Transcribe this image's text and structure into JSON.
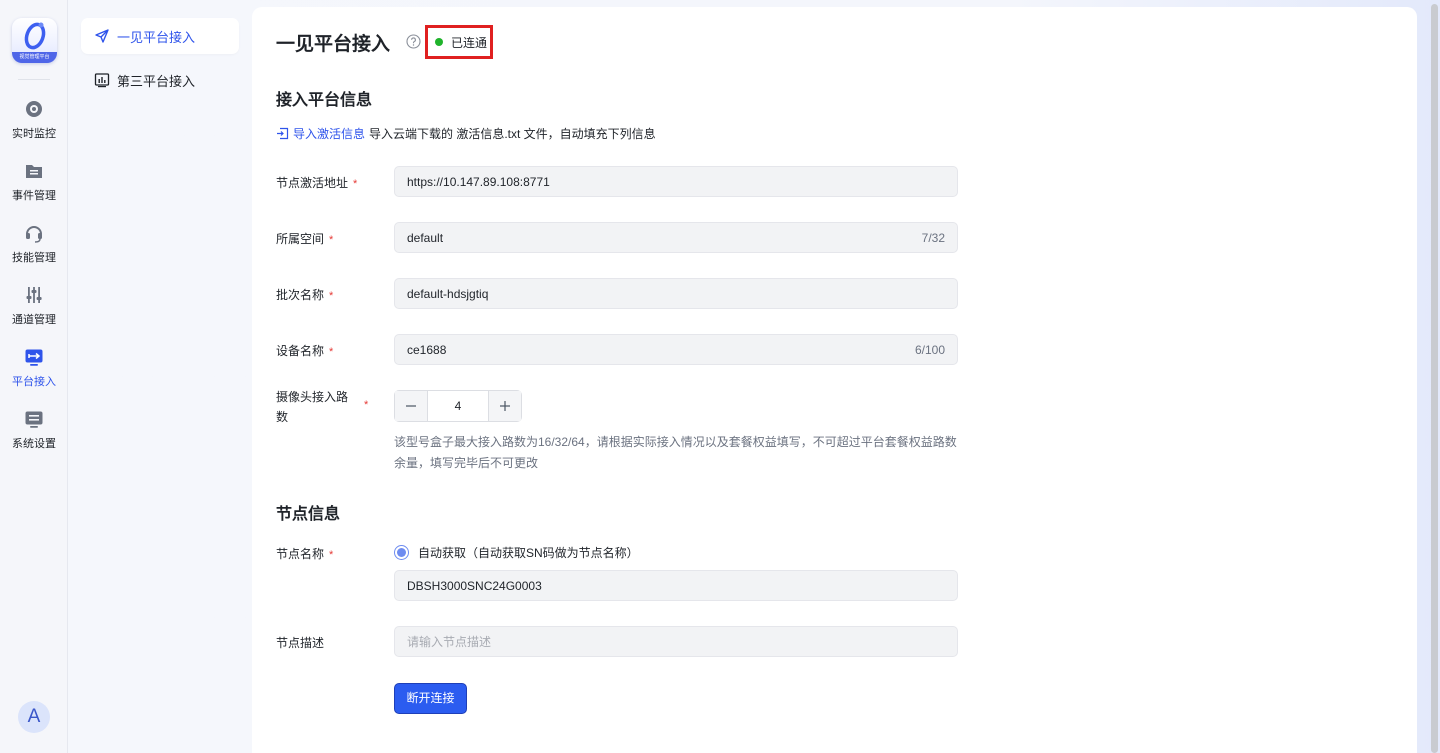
{
  "app": {
    "logo_text": "视觉管理平台"
  },
  "rail": {
    "items": [
      {
        "label": "实时监控",
        "icon": "monitor-icon"
      },
      {
        "label": "事件管理",
        "icon": "folder-list-icon"
      },
      {
        "label": "技能管理",
        "icon": "headset-icon"
      },
      {
        "label": "通道管理",
        "icon": "sliders-icon"
      },
      {
        "label": "平台接入",
        "icon": "screen-arrow-icon",
        "active": true
      },
      {
        "label": "系统设置",
        "icon": "settings-panel-icon"
      }
    ],
    "avatar": "A"
  },
  "subnav": {
    "items": [
      {
        "label": "一见平台接入",
        "icon": "send-icon",
        "active": true
      },
      {
        "label": "第三平台接入",
        "icon": "chart-board-icon"
      }
    ]
  },
  "main": {
    "title": "一见平台接入",
    "status": "已连通",
    "status_color": "#1fb32b",
    "section_access": "接入平台信息",
    "import_link": "导入激活信息",
    "import_desc": "导入云端下载的 激活信息.txt 文件，自动填充下列信息",
    "fields": {
      "address": {
        "label": "节点激活地址",
        "value": "https://10.147.89.108:8771"
      },
      "space": {
        "label": "所属空间",
        "value": "default",
        "count": "7/32"
      },
      "batch": {
        "label": "批次名称",
        "value": "default-hdsjgtiq"
      },
      "device": {
        "label": "设备名称",
        "value": "ce1688",
        "count": "6/100"
      },
      "cameras": {
        "label": "摄像头接入路数",
        "value": "4"
      }
    },
    "camera_hint": "该型号盒子最大接入路数为16/32/64，请根据实际接入情况以及套餐权益填写，不可超过平台套餐权益路数余量，填写完毕后不可更改",
    "section_node": "节点信息",
    "node": {
      "name_label": "节点名称",
      "radio_label": "自动获取（自动获取SN码做为节点名称）",
      "name_value": "DBSH3000SNC24G0003",
      "desc_label": "节点描述",
      "desc_placeholder": "请输入节点描述"
    },
    "disconnect_button": "断开连接",
    "required_mark": "*",
    "accent_color": "#2f54eb"
  }
}
